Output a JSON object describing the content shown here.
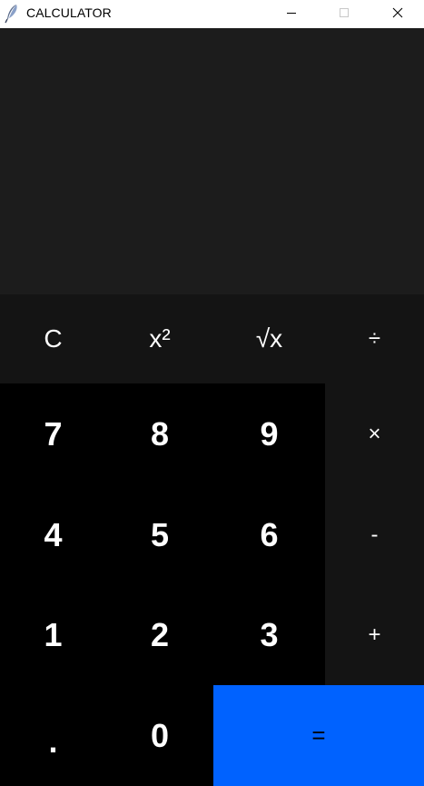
{
  "window": {
    "title": "CALCULATOR",
    "icon": "feather-icon",
    "controls": {
      "minimize": "minimize-icon",
      "maximize": "maximize-icon",
      "close": "close-icon"
    }
  },
  "display": {
    "value": ""
  },
  "colors": {
    "display_bg": "#1c1c1c",
    "function_key_bg": "#141414",
    "number_key_bg": "#000000",
    "equals_key_bg": "#0062ff",
    "key_text": "#ffffff"
  },
  "keys": {
    "clear": "C",
    "square": "x²",
    "sqrt": "√x",
    "divide": "÷",
    "seven": "7",
    "eight": "8",
    "nine": "9",
    "multiply": "×",
    "four": "4",
    "five": "5",
    "six": "6",
    "subtract": "-",
    "one": "1",
    "two": "2",
    "three": "3",
    "add": "+",
    "decimal": ".",
    "zero": "0",
    "equals": "="
  }
}
